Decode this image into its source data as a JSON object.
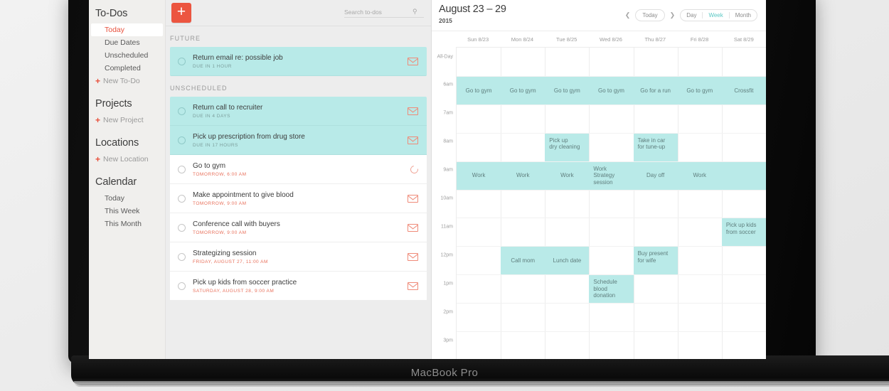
{
  "device": {
    "brand_label": "MacBook Pro"
  },
  "sidebar": {
    "groups": [
      {
        "title": "To-Dos",
        "links": [
          {
            "label": "Today",
            "selected": true
          },
          {
            "label": "Due Dates",
            "selected": false
          },
          {
            "label": "Unscheduled",
            "selected": false
          },
          {
            "label": "Completed",
            "selected": false
          }
        ],
        "new_label": "New To-Do"
      },
      {
        "title": "Projects",
        "links": [],
        "new_label": "New Project"
      },
      {
        "title": "Locations",
        "links": [],
        "new_label": "New Location"
      },
      {
        "title": "Calendar",
        "links": [
          {
            "label": "Today",
            "selected": false
          },
          {
            "label": "This Week",
            "selected": false
          },
          {
            "label": "This Month",
            "selected": false
          }
        ],
        "new_label": ""
      }
    ]
  },
  "todo_panel": {
    "add_button_label": "+",
    "search": {
      "placeholder": "Search to-dos",
      "value": "",
      "icon": "search-icon"
    },
    "sections": [
      {
        "label": "FUTURE",
        "tasks": [
          {
            "title": "Return email re: possible job",
            "due": "DUE IN 1 HOUR",
            "highlighted": true,
            "icon": "envelope-icon"
          }
        ]
      },
      {
        "label": "UNSCHEDULED",
        "tasks": [
          {
            "title": "Return call to recruiter",
            "due": "DUE IN 4 DAYS",
            "highlighted": true,
            "icon": "envelope-icon"
          },
          {
            "title": "Pick up prescription from drug store",
            "due": "DUE IN 17 HOURS",
            "highlighted": true,
            "icon": "envelope-icon"
          },
          {
            "title": "Go to gym",
            "due": "TOMORROW, 6:00 AM",
            "highlighted": false,
            "icon": "repeat-icon"
          },
          {
            "title": "Make appointment to give blood",
            "due": "TOMORROW, 9:00 AM",
            "highlighted": false,
            "icon": "envelope-icon"
          },
          {
            "title": "Conference call with buyers",
            "due": "TOMORROW, 9:00 AM",
            "highlighted": false,
            "icon": "envelope-icon"
          },
          {
            "title": "Strategizing session",
            "due": "FRIDAY, AUGUST 27, 11:00 AM",
            "highlighted": false,
            "icon": "envelope-icon"
          },
          {
            "title": "Pick up kids from soccer practice",
            "due": "SATURDAY, AUGUST 28, 9:00 AM",
            "highlighted": false,
            "icon": "envelope-icon"
          }
        ]
      }
    ]
  },
  "calendar": {
    "range_title": "August 23 – 29",
    "year": "2015",
    "prev_icon": "chevron-left-icon",
    "next_icon": "chevron-right-icon",
    "today_label": "Today",
    "views": [
      {
        "label": "Day",
        "active": false
      },
      {
        "label": "Week",
        "active": true
      },
      {
        "label": "Month",
        "active": false
      }
    ],
    "day_headers": [
      "Sun 8/23",
      "Mon 8/24",
      "Tue 8/25",
      "Wed 8/26",
      "Thu 8/27",
      "Fri 8/28",
      "Sat 8/29"
    ],
    "time_labels": [
      "All-Day",
      "6am",
      "7am",
      "8am",
      "9am",
      "10am",
      "11am",
      "12pm",
      "1pm",
      "2pm",
      "3pm"
    ],
    "events": [
      {
        "title": "Go to gym",
        "day": 0,
        "slot": 1,
        "span": 1
      },
      {
        "title": "Go to gym",
        "day": 1,
        "slot": 1,
        "span": 1
      },
      {
        "title": "Go to gym",
        "day": 2,
        "slot": 1,
        "span": 1
      },
      {
        "title": "Go to gym",
        "day": 3,
        "slot": 1,
        "span": 1
      },
      {
        "title": "Go for a run",
        "day": 4,
        "slot": 1,
        "span": 1
      },
      {
        "title": "Go to gym",
        "day": 5,
        "slot": 1,
        "span": 1
      },
      {
        "title": "Crossfit",
        "day": 6,
        "slot": 1,
        "span": 1
      },
      {
        "title": "Pick up\ndry cleaning",
        "day": 2,
        "slot": 3,
        "span": 1
      },
      {
        "title": "Take in car\nfor tune-up",
        "day": 4,
        "slot": 3,
        "span": 1
      },
      {
        "title": "Work",
        "day": 0,
        "slot": 4,
        "span": 1
      },
      {
        "title": "Work",
        "day": 1,
        "slot": 4,
        "span": 1
      },
      {
        "title": "Work",
        "day": 2,
        "slot": 4,
        "span": 1
      },
      {
        "title": "Work\nStrategy\nsession",
        "day": 3,
        "slot": 4,
        "span": 1
      },
      {
        "title": "Day off",
        "day": 4,
        "slot": 4,
        "span": 1
      },
      {
        "title": "Work",
        "day": 5,
        "slot": 4,
        "span": 1
      },
      {
        "title": "",
        "day": 6,
        "slot": 4,
        "span": 1
      },
      {
        "title": "Pick up kids\nfrom soccer",
        "day": 6,
        "slot": 6,
        "span": 1
      },
      {
        "title": "Call mom",
        "day": 1,
        "slot": 7,
        "span": 1
      },
      {
        "title": "Lunch date",
        "day": 2,
        "slot": 7,
        "span": 1
      },
      {
        "title": "Buy present\nfor wife",
        "day": 4,
        "slot": 7,
        "span": 1
      },
      {
        "title": "Schedule\nblood\ndonation",
        "day": 3,
        "slot": 8,
        "span": 1
      }
    ]
  },
  "colors": {
    "accent_red": "#ec5540",
    "accent_teal": "#b9eae8",
    "active_teal": "#5bc8c4",
    "sidebar_bg": "#f0efed",
    "panel_bg": "#ededed"
  }
}
